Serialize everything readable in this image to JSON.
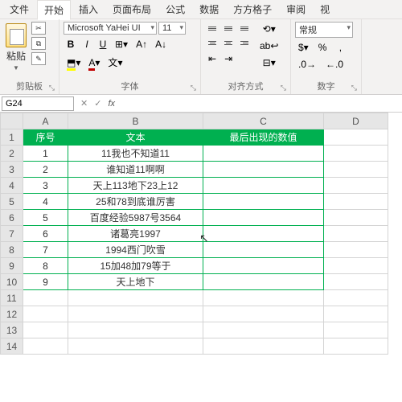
{
  "menu": {
    "file": "文件",
    "home": "开始",
    "insert": "插入",
    "layout": "页面布局",
    "formula": "公式",
    "data": "数据",
    "grid": "方方格子",
    "review": "审阅",
    "view": "视"
  },
  "ribbon": {
    "clipboard": {
      "paste": "粘贴",
      "label": "剪贴板"
    },
    "font": {
      "name": "Microsoft YaHei UI",
      "size": "11",
      "label": "字体",
      "bold": "B",
      "italic": "I",
      "underline": "U",
      "wen": "文"
    },
    "align": {
      "label": "对齐方式",
      "wrap": "ab↩"
    },
    "number": {
      "format": "常规",
      "label": "数字"
    }
  },
  "namebox": "G24",
  "colheads": [
    "A",
    "B",
    "C",
    "D"
  ],
  "headers": {
    "a": "序号",
    "b": "文本",
    "c": "最后出现的数值"
  },
  "rows": [
    {
      "n": "1",
      "t": "11我也不知道11"
    },
    {
      "n": "2",
      "t": "谁知道11啊啊"
    },
    {
      "n": "3",
      "t": "天上113地下23上12"
    },
    {
      "n": "4",
      "t": "25和78到底谁厉害"
    },
    {
      "n": "5",
      "t": "百度经验5987号3564"
    },
    {
      "n": "6",
      "t": "诸葛亮1997"
    },
    {
      "n": "7",
      "t": "1994西门吹雪"
    },
    {
      "n": "8",
      "t": "15加48加79等于"
    },
    {
      "n": "9",
      "t": "天上地下"
    }
  ],
  "fx": "fx"
}
